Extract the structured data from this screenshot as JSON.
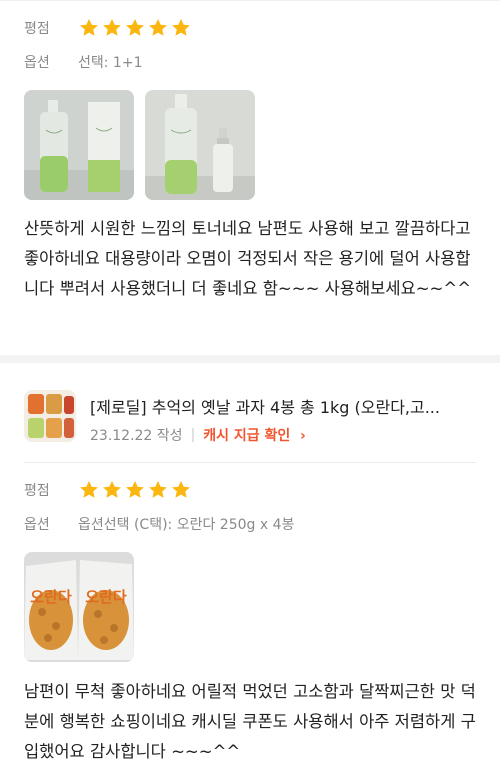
{
  "reviews": [
    {
      "rating_label": "평점",
      "rating": 5,
      "option_label": "옵션",
      "option_value": "선택: 1+1",
      "text": "산뜻하게 시원한 느낌의 토너네요 남편도 사용해 보고 깔끔하다고 좋아하네요 대용량이라 오몀이 걱정되서 작은 용기에 덜어 사용합니다 뿌려서 사용했더니 더 좋네요 함~~~ 사용해보세요~~^^"
    },
    {
      "product_title": "[제로딜] 추억의 옛날 과자 4봉 총 1kg (오란다,고...",
      "date": "23.12.22 작성",
      "cash_label": "캐시 지급 확인",
      "rating_label": "평점",
      "rating": 5,
      "option_label": "옵션",
      "option_value": "옵션선택 (C택): 오란다 250g x 4봉",
      "bag_label": "오란다",
      "text": "남편이 무척 좋아하네요 어릴적 먹었던 고소함과 달짝찌근한 맛 덕분에 행복한 쇼핑이네요 캐시딜 쿠폰도 사용해서 아주 저렴하게 구입했어요 감사합니다 ~~~^^"
    }
  ],
  "colors": {
    "star": "#fbb60f",
    "accent": "#f0562e",
    "muted": "#8a8a8a"
  }
}
